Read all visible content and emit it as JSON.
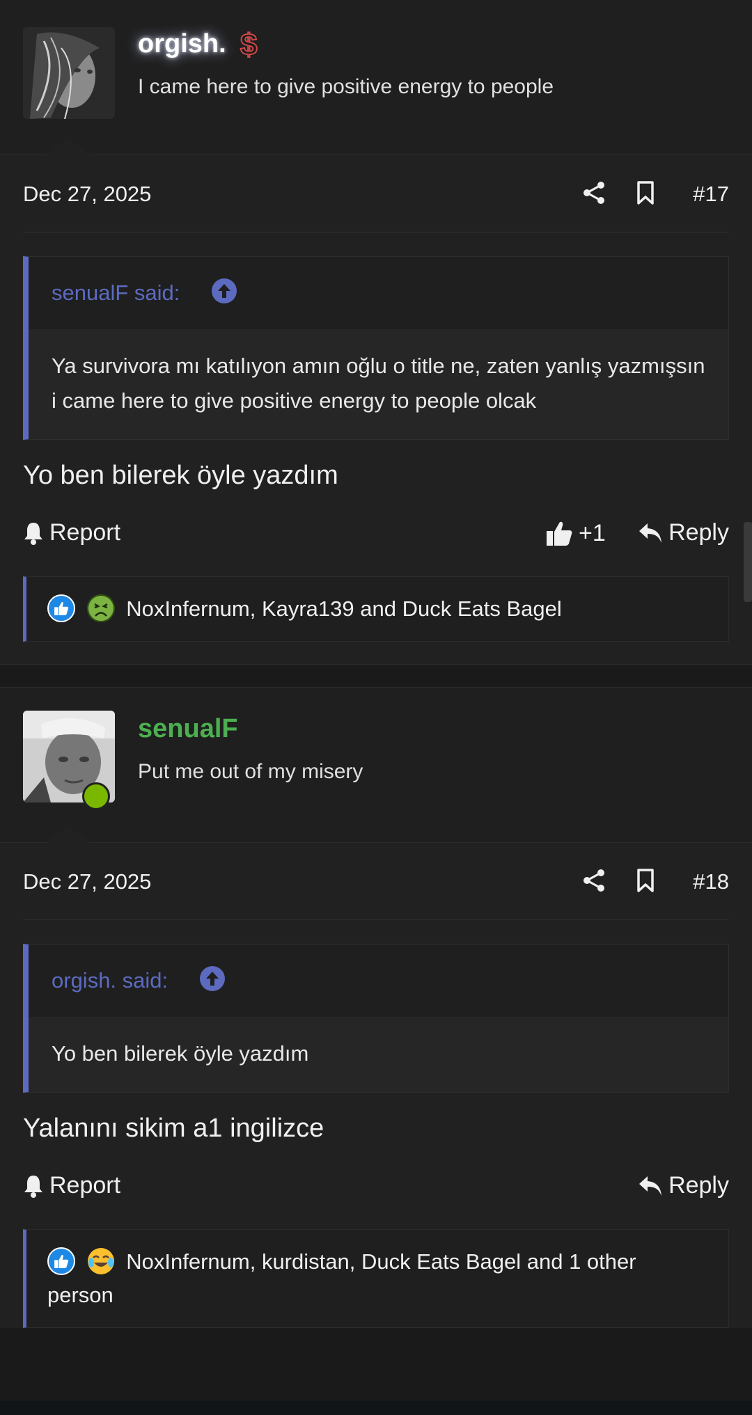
{
  "posts": [
    {
      "user": {
        "name": "orgish.",
        "title": "I came here to give positive energy to people",
        "badge_icon": "dollar-icon"
      },
      "date": "Dec 27, 2025",
      "number": "#17",
      "quote": {
        "author_label": "senualF said:",
        "text": "Ya survivora mı katılıyon amın oğlu o title ne, zaten yanlış yazmışsın i came here to give positive energy to people olcak"
      },
      "body": "Yo ben bilerek öyle yazdım",
      "actions": {
        "report": "Report",
        "like_count": "+1",
        "reply": "Reply"
      },
      "reactions": {
        "icons": [
          "like-icon",
          "sick-face-icon"
        ],
        "text": "NoxInfernum, Kayra139 and Duck Eats Bagel"
      }
    },
    {
      "user": {
        "name": "senualF",
        "title": "Put me out of my misery",
        "online": true
      },
      "date": "Dec 27, 2025",
      "number": "#18",
      "quote": {
        "author_label": "orgish. said:",
        "text": "Yo ben bilerek öyle yazdım"
      },
      "body": "Yalanını sikim a1 ingilizce",
      "actions": {
        "report": "Report",
        "reply": "Reply"
      },
      "reactions": {
        "icons": [
          "like-icon",
          "crying-laughing-icon"
        ],
        "text": "NoxInfernum, kurdistan, Duck Eats Bagel and 1 other person"
      }
    }
  ],
  "colors": {
    "accent": "#5c6bc0",
    "online": "#7ab800",
    "username_green": "#4caf50",
    "background": "#212121"
  }
}
